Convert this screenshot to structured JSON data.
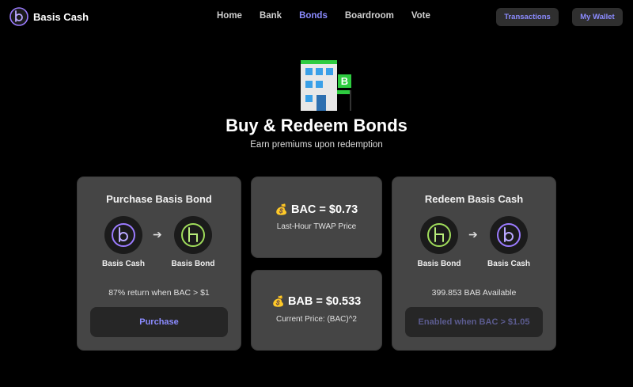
{
  "app": {
    "name": "Basis Cash"
  },
  "nav": {
    "items": [
      {
        "label": "Home",
        "active": false
      },
      {
        "label": "Bank",
        "active": false
      },
      {
        "label": "Bonds",
        "active": true
      },
      {
        "label": "Boardroom",
        "active": false
      },
      {
        "label": "Vote",
        "active": false
      }
    ]
  },
  "header": {
    "transactions_label": "Transactions",
    "wallet_label": "My Wallet"
  },
  "hero": {
    "title": "Buy & Redeem Bonds",
    "subtitle": "Earn premiums upon redemption"
  },
  "purchase": {
    "title": "Purchase Basis Bond",
    "from_token": "Basis Cash",
    "to_token": "Basis Bond",
    "info": "87% return when BAC > $1",
    "button_label": "Purchase"
  },
  "bac_price": {
    "value": "BAC = $0.73",
    "caption": "Last-Hour TWAP Price"
  },
  "bab_price": {
    "value": "BAB = $0.533",
    "caption": "Current Price: (BAC)^2"
  },
  "redeem": {
    "title": "Redeem Basis Cash",
    "from_token": "Basis Bond",
    "to_token": "Basis Cash",
    "info": "399.853 BAB Available",
    "button_label": "Enabled when BAC > $1.05"
  },
  "colors": {
    "accent": "#8b8bff",
    "card": "#454545",
    "button": "#262626",
    "cash_ring": "#9b7bff",
    "bond_ring": "#9fdc5a"
  },
  "icons": {
    "logo": "basis-cash-logo-icon",
    "hero": "bank-building-icon",
    "money_bag": "money-bag-icon",
    "arrow": "arrow-right-icon"
  }
}
